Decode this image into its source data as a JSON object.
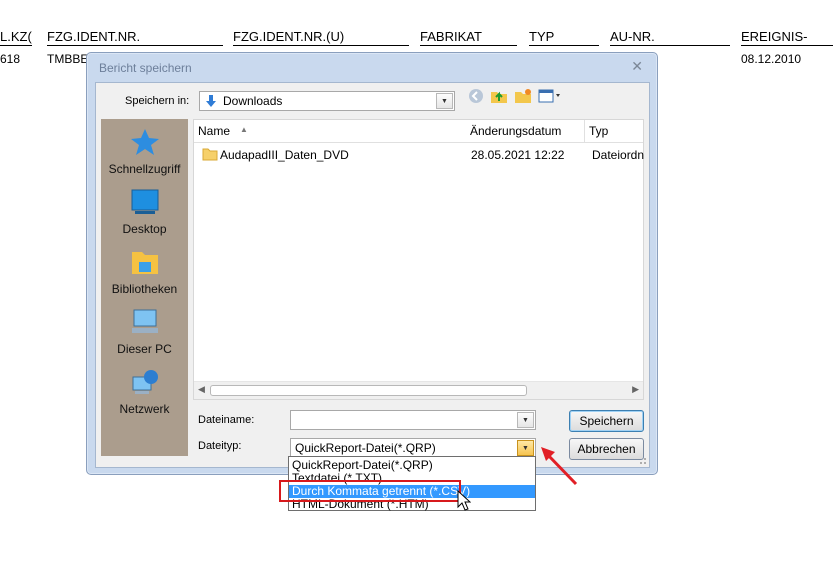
{
  "background": {
    "headers": [
      "L.KZ(",
      "FZG.IDENT.NR.",
      "FZG.IDENT.NR.(U)",
      "FABRIKAT",
      "TYP",
      "AU-NR.",
      "EREIGNIS-"
    ],
    "values": [
      "618",
      "TMBBE",
      "08.12.2010"
    ]
  },
  "dialog": {
    "title": "Bericht speichern",
    "save_in_label": "Speichern in:",
    "save_in_value": "Downloads",
    "places": [
      "Schnellzugriff",
      "Desktop",
      "Bibliotheken",
      "Dieser PC",
      "Netzwerk"
    ],
    "columns": [
      "Name",
      "Änderungsdatum",
      "Typ"
    ],
    "files": [
      {
        "name": "AudapadIII_Daten_DVD",
        "date": "28.05.2021 12:22",
        "type": "Dateiordn"
      }
    ],
    "filename_label": "Dateiname:",
    "filename_value": "",
    "filetype_label": "Dateityp:",
    "filetype_value": "QuickReport-Datei(*.QRP)",
    "save_button": "Speichern",
    "cancel_button": "Abbrechen",
    "filetype_options": [
      "QuickReport-Datei(*.QRP)",
      "Textdatei (*.TXT)",
      "Durch Kommata getrennt (*.CSV)",
      "HTML-Dokument (*.HTM)"
    ],
    "selected_option_index": 2
  },
  "colors": {
    "selection": "#3399ff",
    "highlight_box": "#d7191c",
    "arrow": "#e11f26",
    "places_bg": "#ab9d8d"
  }
}
